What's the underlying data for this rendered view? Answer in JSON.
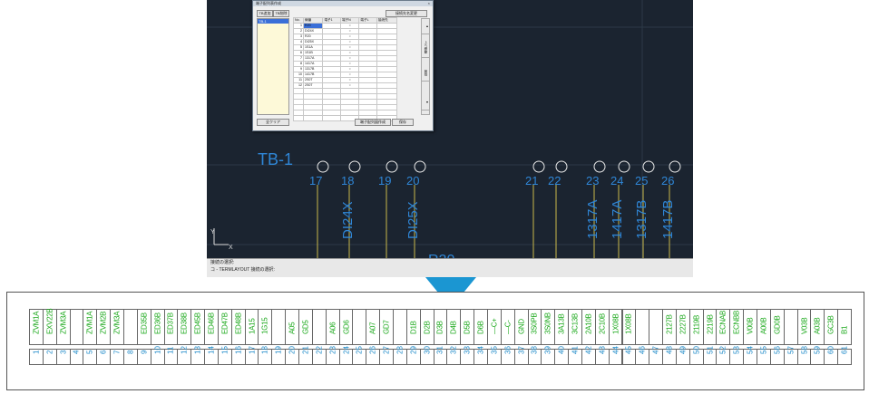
{
  "cad": {
    "board_label": "TB-1",
    "bottom_label": "R20",
    "terminals": [
      {
        "num": "17",
        "signal": ""
      },
      {
        "num": "18",
        "signal": "DI24X"
      },
      {
        "num": "19",
        "signal": ""
      },
      {
        "num": "20",
        "signal": "DI25X"
      },
      {
        "num": "21",
        "signal": ""
      },
      {
        "num": "22",
        "signal": ""
      },
      {
        "num": "23",
        "signal": "1317A"
      },
      {
        "num": "24",
        "signal": "1417A"
      },
      {
        "num": "25",
        "signal": "1317B"
      },
      {
        "num": "26",
        "signal": "1417B"
      }
    ],
    "axis_y": "Y",
    "axis_x": "X"
  },
  "command": {
    "line1": "接続の選択:",
    "line2": "コ - TERMLAYOUT 接続の選択:"
  },
  "dialog": {
    "title": "端子配列表作成",
    "close": "×",
    "btn_tb_add": "TB追加",
    "btn_tb_del": "TB削除",
    "btn_rename": "接続先名変更",
    "list_selected": "TB-1",
    "headers": [
      "No.",
      "線番",
      "端子1",
      "端子N",
      "端子L",
      "接続先"
    ],
    "rows": [
      {
        "no": "1",
        "wire": "R20",
        "mark": "○"
      },
      {
        "no": "2",
        "wire": "DI24X",
        "mark": "○"
      },
      {
        "no": "3",
        "wire": "R20",
        "mark": "○"
      },
      {
        "no": "4",
        "wire": "DI25X",
        "mark": "○"
      },
      {
        "no": "5",
        "wire": "1S1A",
        "mark": "○"
      },
      {
        "no": "6",
        "wire": "1S1B",
        "mark": "○"
      },
      {
        "no": "7",
        "wire": "1317A",
        "mark": "○"
      },
      {
        "no": "8",
        "wire": "1417A",
        "mark": "○"
      },
      {
        "no": "9",
        "wire": "1317B",
        "mark": "○"
      },
      {
        "no": "10",
        "wire": "1417B",
        "mark": "○"
      },
      {
        "no": "11",
        "wire": "2S0T",
        "mark": "○"
      },
      {
        "no": "12",
        "wire": "2S0T",
        "mark": "○"
      }
    ],
    "side_buttons": [
      "▲",
      "上へ移動",
      "削除",
      "▼"
    ],
    "btn_clear": "全クリア",
    "btn_create": "端子配列図作成",
    "btn_save": "保存"
  },
  "strip": [
    {
      "n": "1",
      "s": "ZVM1A"
    },
    {
      "n": "2",
      "s": "EXV22B"
    },
    {
      "n": "3",
      "s": "ZVM3A"
    },
    {
      "n": "4",
      "s": ""
    },
    {
      "n": "5",
      "s": "ZVM1A"
    },
    {
      "n": "6",
      "s": "ZVM2B"
    },
    {
      "n": "7",
      "s": "ZVM3A"
    },
    {
      "n": "8",
      "s": ""
    },
    {
      "n": "9",
      "s": "ED35B"
    },
    {
      "n": "10",
      "s": "ED36B"
    },
    {
      "n": "11",
      "s": "ED37B"
    },
    {
      "n": "12",
      "s": "ED38B"
    },
    {
      "n": "13",
      "s": "ED45B"
    },
    {
      "n": "14",
      "s": "ED46B"
    },
    {
      "n": "15",
      "s": "ED47B"
    },
    {
      "n": "16",
      "s": "ED48B"
    },
    {
      "n": "17",
      "s": "1A15"
    },
    {
      "n": "18",
      "s": "1G15"
    },
    {
      "n": "19",
      "s": ""
    },
    {
      "n": "20",
      "s": "A05"
    },
    {
      "n": "21",
      "s": "GD5"
    },
    {
      "n": "22",
      "s": ""
    },
    {
      "n": "23",
      "s": "A06"
    },
    {
      "n": "24",
      "s": "GD6"
    },
    {
      "n": "25",
      "s": ""
    },
    {
      "n": "26",
      "s": "A07"
    },
    {
      "n": "27",
      "s": "GD7"
    },
    {
      "n": "28",
      "s": ""
    },
    {
      "n": "29",
      "s": "D1B"
    },
    {
      "n": "30",
      "s": "D2B"
    },
    {
      "n": "31",
      "s": "D3B"
    },
    {
      "n": "32",
      "s": "D4B"
    },
    {
      "n": "33",
      "s": "D5B"
    },
    {
      "n": "34",
      "s": "D6B"
    },
    {
      "n": "35",
      "s": "—C+"
    },
    {
      "n": "36",
      "s": "—C-"
    },
    {
      "n": "37",
      "s": "GND"
    },
    {
      "n": "38",
      "s": "3S0PB"
    },
    {
      "n": "39",
      "s": "3S0NB"
    },
    {
      "n": "40",
      "s": "3A13B"
    },
    {
      "n": "41",
      "s": "3C13B"
    },
    {
      "n": "42",
      "s": "2A10B"
    },
    {
      "n": "43",
      "s": "2C10B"
    },
    {
      "n": "44",
      "s": "1X08B"
    },
    {
      "n": "45",
      "s": "1X08B"
    },
    {
      "n": "46",
      "s": ""
    },
    {
      "n": "47",
      "s": ""
    },
    {
      "n": "48",
      "s": "2127B"
    },
    {
      "n": "49",
      "s": "2227B"
    },
    {
      "n": "50",
      "s": "2119B"
    },
    {
      "n": "51",
      "s": "2219B"
    },
    {
      "n": "52",
      "s": "ECNAB"
    },
    {
      "n": "53",
      "s": "ECNBB"
    },
    {
      "n": "54",
      "s": "V00B"
    },
    {
      "n": "55",
      "s": "A00B"
    },
    {
      "n": "56",
      "s": "GD0B"
    },
    {
      "n": "57",
      "s": ""
    },
    {
      "n": "58",
      "s": "V03B"
    },
    {
      "n": "59",
      "s": "A03B"
    },
    {
      "n": "60",
      "s": "GC3B"
    },
    {
      "n": "61",
      "s": "B1"
    }
  ],
  "colors": {
    "cad_bg": "#1b2430",
    "cad_line": "#c9b84a",
    "cad_blue": "#2f86d6",
    "strip_green": "#1aa81a",
    "strip_blue": "#1a88c8",
    "arrow": "#1b96d2"
  }
}
